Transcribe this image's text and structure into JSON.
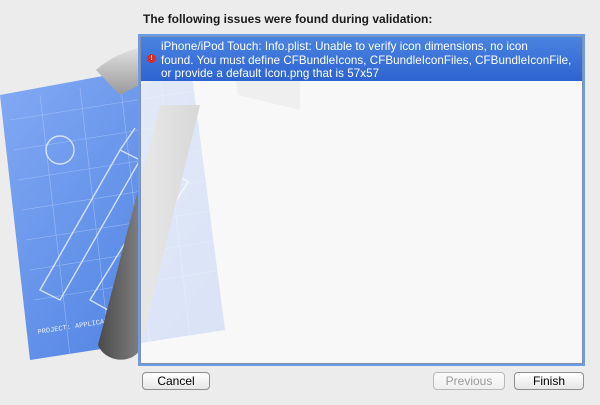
{
  "window": {
    "heading": "The following issues were found during validation:"
  },
  "issues": [
    {
      "severity_icon": "error-icon",
      "lines": [
        "iPhone/iPod Touch: Info.plist: Unable to verify icon dimensions, no icon",
        "found.  You must define CFBundleIcons, CFBundleIconFiles, CFBundleIconFile,",
        "or provide a default Icon.png that is 57x57"
      ]
    }
  ],
  "background_art": {
    "blueprint_caption": "PROJECT: APPLICATION.APP"
  },
  "buttons": {
    "cancel_label": "Cancel",
    "previous_label": "Previous",
    "finish_label": "Finish"
  },
  "colors": {
    "selection": "#2d63d1",
    "error": "#e02a24",
    "blueprint": "#4f86ea"
  }
}
